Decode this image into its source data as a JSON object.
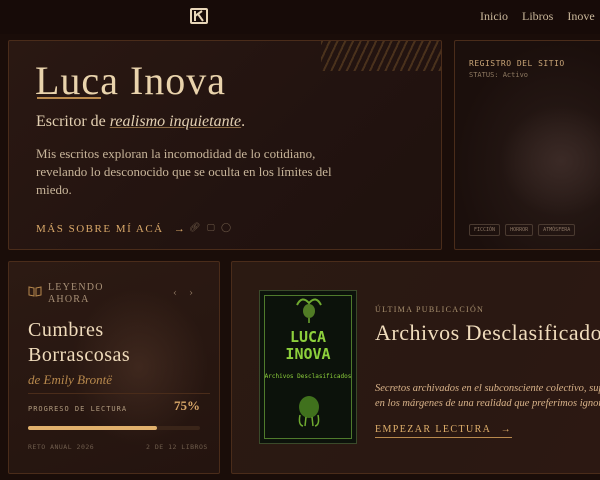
{
  "nav": {
    "items": [
      "Inicio",
      "Libros",
      "Inove"
    ]
  },
  "hero": {
    "name": "Luca Inova",
    "tagline_prefix": "Escritor de",
    "tagline_emphasis": "realismo inquietante",
    "tagline_suffix": ".",
    "description": "Mis escritos exploran la incomodidad de lo cotidiano, revelando lo desconocido que se oculta en los límites del miedo.",
    "link_label": "MÁS SOBRE MÍ ACÁ",
    "link_arrow": "→"
  },
  "log": {
    "title": "REGISTRO DEL SITIO",
    "status": "STATUS: Activo",
    "tags": [
      "FICCIÓN",
      "HORROR",
      "ATMÓSFERA"
    ]
  },
  "reading": {
    "label": "LEYENDO AHORA",
    "title": "Cumbres Borrascosas",
    "author": "de Emily Brontë",
    "progress_label": "PROGRESO DE LECTURA",
    "progress_value": "75%",
    "progress_fraction": 0.75,
    "goal_label": "RETO ANUAL 2026",
    "goal_count": "2 DE 12 LIBROS"
  },
  "latest": {
    "label": "ÚLTIMA PUBLICACIÓN",
    "title": "Archivos Desclasificados",
    "description_line1": "Secretos archivados en el subconsciente colectivo, supu",
    "description_line2": "en los márgenes de una realidad que preferimos ignor",
    "cta": "EMPEZAR LECTURA",
    "cta_arrow": "→",
    "cover": {
      "title_line1": "LUCA",
      "title_line2": "INOVA",
      "subtitle": "Archivos Desclasificados"
    }
  },
  "colors": {
    "accent": "#d9a869",
    "background": "#1a0d09",
    "cover_green": "#8dd03c"
  }
}
